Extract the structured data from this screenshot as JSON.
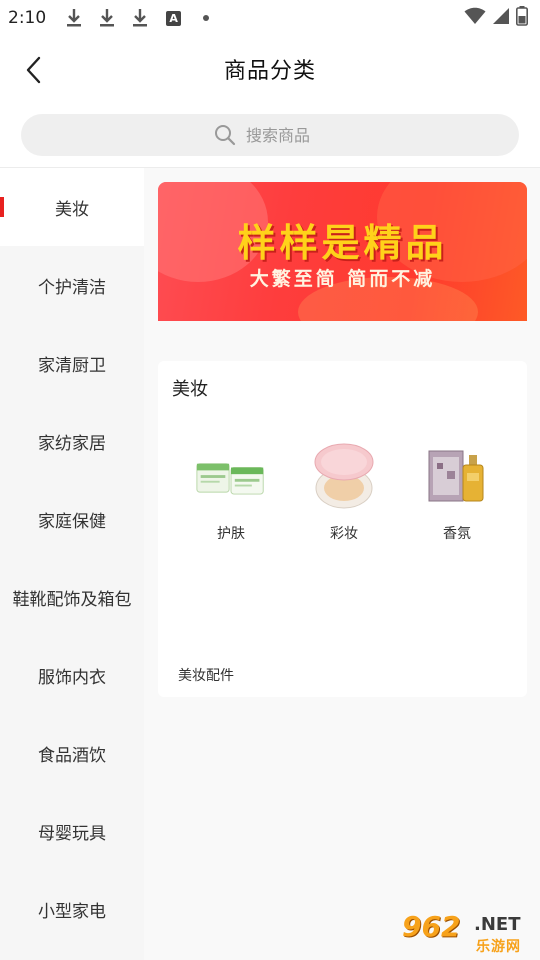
{
  "status_bar": {
    "time": "2:10",
    "icons": [
      "download-icon",
      "download-icon",
      "download-icon",
      "a-notification-icon",
      "dot-icon",
      "wifi-icon",
      "signal-icon",
      "battery-icon"
    ],
    "a_icon_letter": "A"
  },
  "header": {
    "title": "商品分类",
    "back_icon": "back-arrow-icon"
  },
  "search": {
    "placeholder": "搜索商品",
    "icon": "search-icon"
  },
  "sidebar": {
    "items": [
      {
        "label": "美妆",
        "active": true
      },
      {
        "label": "个护清洁",
        "active": false
      },
      {
        "label": "家清厨卫",
        "active": false
      },
      {
        "label": "家纺家居",
        "active": false
      },
      {
        "label": "家庭保健",
        "active": false
      },
      {
        "label": "鞋靴配饰及箱包",
        "active": false
      },
      {
        "label": "服饰内衣",
        "active": false
      },
      {
        "label": "食品酒饮",
        "active": false
      },
      {
        "label": "母婴玩具",
        "active": false
      },
      {
        "label": "小型家电",
        "active": false
      }
    ],
    "accent_color": "#e8211f"
  },
  "banner": {
    "title": "样样是精品",
    "subtitle": "大繁至简 简而不减"
  },
  "category_card": {
    "title": "美妆",
    "items": [
      {
        "label": "护肤",
        "icon": "skincare-jars-icon"
      },
      {
        "label": "彩妆",
        "icon": "cushion-compact-icon"
      },
      {
        "label": "香氛",
        "icon": "perfume-bottle-icon"
      },
      {
        "label": "美妆配件"
      }
    ]
  },
  "watermark": {
    "number": "962",
    "suffix": ".NET",
    "site": "乐游网"
  }
}
